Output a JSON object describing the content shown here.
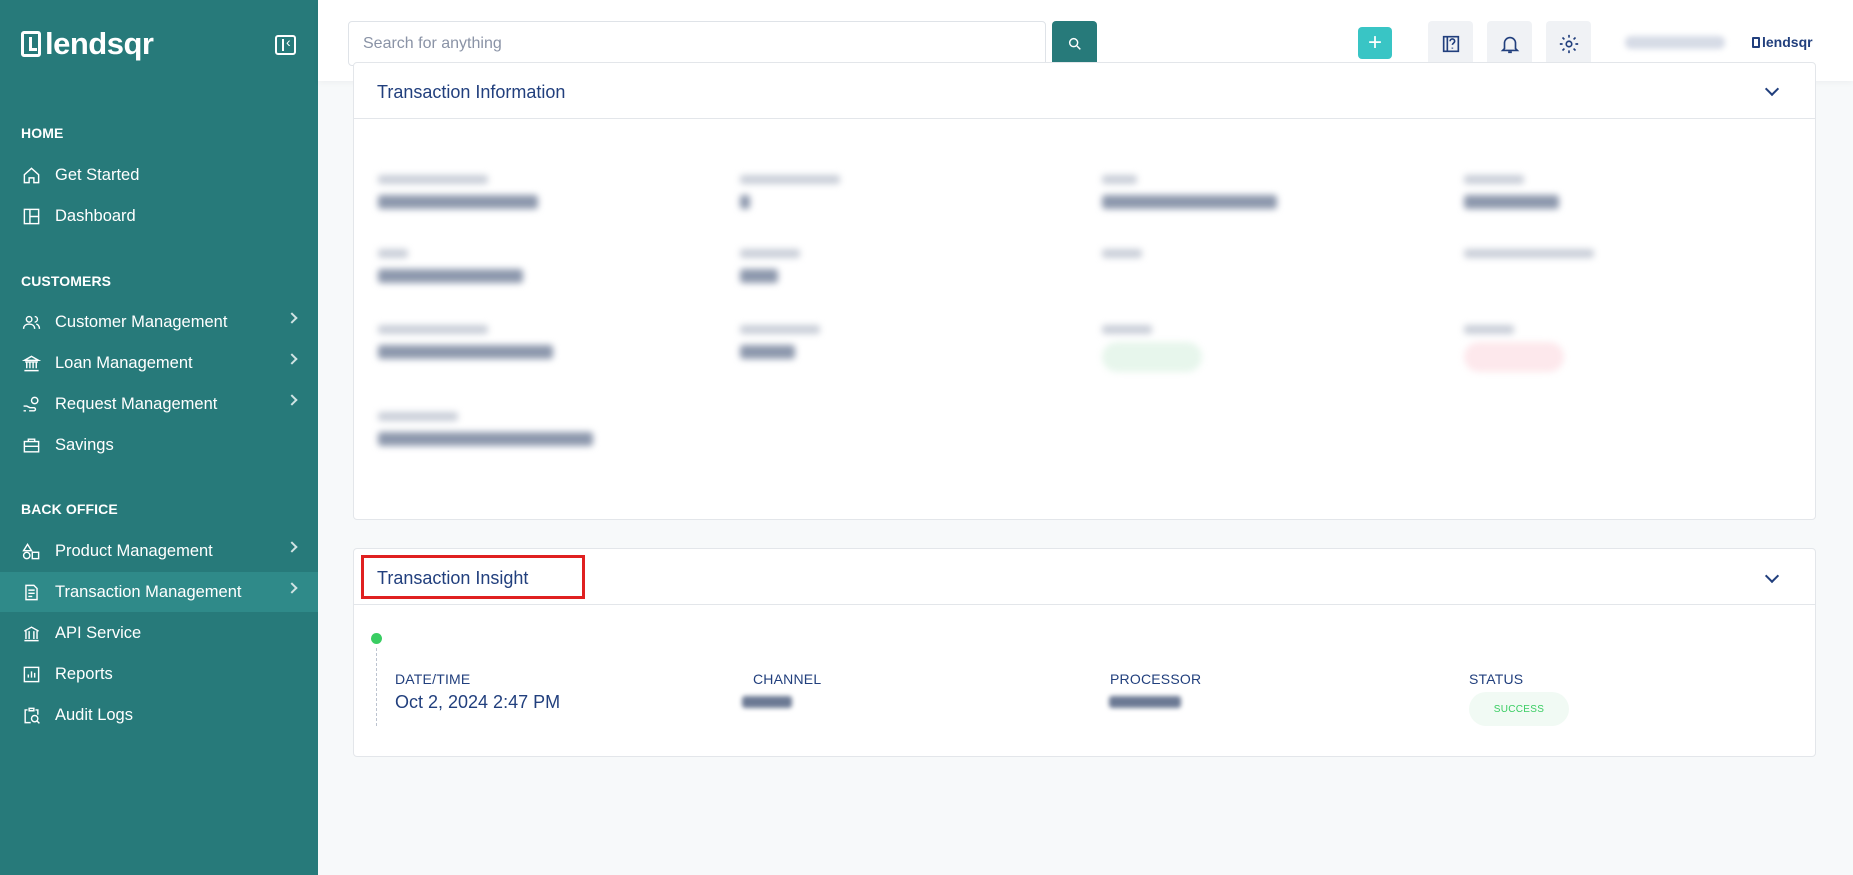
{
  "app": {
    "brand": "lendsqr"
  },
  "sidebar": {
    "sections": [
      {
        "title": "HOME",
        "items": [
          {
            "label": "Get Started",
            "icon": "home-icon"
          },
          {
            "label": "Dashboard",
            "icon": "dashboard-icon"
          }
        ]
      },
      {
        "title": "CUSTOMERS",
        "items": [
          {
            "label": "Customer Management",
            "icon": "users-icon",
            "has_submenu": true
          },
          {
            "label": "Loan Management",
            "icon": "loan-icon",
            "has_submenu": true
          },
          {
            "label": "Request Management",
            "icon": "request-icon",
            "has_submenu": true
          },
          {
            "label": "Savings",
            "icon": "briefcase-icon"
          }
        ]
      },
      {
        "title": "BACK OFFICE",
        "items": [
          {
            "label": "Product Management",
            "icon": "shapes-icon",
            "has_submenu": true
          },
          {
            "label": "Transaction Management",
            "icon": "transaction-icon",
            "has_submenu": true,
            "active": true
          },
          {
            "label": "API Service",
            "icon": "bank-icon"
          },
          {
            "label": "Reports",
            "icon": "chart-icon"
          },
          {
            "label": "Audit Logs",
            "icon": "audit-icon"
          }
        ]
      }
    ]
  },
  "topbar": {
    "search_placeholder": "Search for anything",
    "plus_label": "+",
    "logo_text": "lendsqr"
  },
  "transaction_information": {
    "title": "Transaction Information"
  },
  "transaction_insight": {
    "title": "Transaction Insight",
    "columns": [
      {
        "label": "DATE/TIME",
        "value": "Oct 2, 2024 2:47 PM"
      },
      {
        "label": "CHANNEL"
      },
      {
        "label": "PROCESSOR"
      },
      {
        "label": "STATUS",
        "badge": "SUCCESS"
      }
    ]
  },
  "colors": {
    "sidebar": "#277a7a",
    "accent": "#39c5c5",
    "text": "#213f7d",
    "success": "#39cd62",
    "highlight": "#e02020"
  }
}
